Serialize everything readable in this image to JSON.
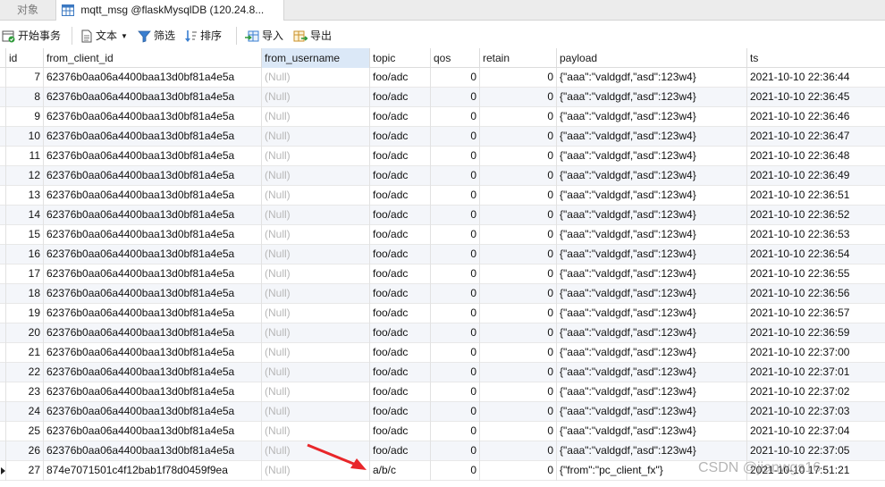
{
  "tabs": {
    "objects": "对象",
    "active": "mqtt_msg @flaskMysqlDB (120.24.8..."
  },
  "toolbar": {
    "begin_transaction": "开始事务",
    "text": "文本",
    "filter": "筛选",
    "sort": "排序",
    "import": "导入",
    "export": "导出"
  },
  "columns": [
    "id",
    "from_client_id",
    "from_username",
    "topic",
    "qos",
    "retain",
    "payload",
    "ts"
  ],
  "selected_column": "from_username",
  "rows": [
    {
      "id": "7",
      "from_client_id": "62376b0aa06a4400baa13d0bf81a4e5a",
      "from_username": "(Null)",
      "topic": "foo/adc",
      "qos": "0",
      "retain": "0",
      "payload": "{\"aaa\":\"valdgdf,\"asd\":123w4}",
      "ts": "2021-10-10 22:36:44"
    },
    {
      "id": "8",
      "from_client_id": "62376b0aa06a4400baa13d0bf81a4e5a",
      "from_username": "(Null)",
      "topic": "foo/adc",
      "qos": "0",
      "retain": "0",
      "payload": "{\"aaa\":\"valdgdf,\"asd\":123w4}",
      "ts": "2021-10-10 22:36:45"
    },
    {
      "id": "9",
      "from_client_id": "62376b0aa06a4400baa13d0bf81a4e5a",
      "from_username": "(Null)",
      "topic": "foo/adc",
      "qos": "0",
      "retain": "0",
      "payload": "{\"aaa\":\"valdgdf,\"asd\":123w4}",
      "ts": "2021-10-10 22:36:46"
    },
    {
      "id": "10",
      "from_client_id": "62376b0aa06a4400baa13d0bf81a4e5a",
      "from_username": "(Null)",
      "topic": "foo/adc",
      "qos": "0",
      "retain": "0",
      "payload": "{\"aaa\":\"valdgdf,\"asd\":123w4}",
      "ts": "2021-10-10 22:36:47"
    },
    {
      "id": "11",
      "from_client_id": "62376b0aa06a4400baa13d0bf81a4e5a",
      "from_username": "(Null)",
      "topic": "foo/adc",
      "qos": "0",
      "retain": "0",
      "payload": "{\"aaa\":\"valdgdf,\"asd\":123w4}",
      "ts": "2021-10-10 22:36:48"
    },
    {
      "id": "12",
      "from_client_id": "62376b0aa06a4400baa13d0bf81a4e5a",
      "from_username": "(Null)",
      "topic": "foo/adc",
      "qos": "0",
      "retain": "0",
      "payload": "{\"aaa\":\"valdgdf,\"asd\":123w4}",
      "ts": "2021-10-10 22:36:49"
    },
    {
      "id": "13",
      "from_client_id": "62376b0aa06a4400baa13d0bf81a4e5a",
      "from_username": "(Null)",
      "topic": "foo/adc",
      "qos": "0",
      "retain": "0",
      "payload": "{\"aaa\":\"valdgdf,\"asd\":123w4}",
      "ts": "2021-10-10 22:36:51"
    },
    {
      "id": "14",
      "from_client_id": "62376b0aa06a4400baa13d0bf81a4e5a",
      "from_username": "(Null)",
      "topic": "foo/adc",
      "qos": "0",
      "retain": "0",
      "payload": "{\"aaa\":\"valdgdf,\"asd\":123w4}",
      "ts": "2021-10-10 22:36:52"
    },
    {
      "id": "15",
      "from_client_id": "62376b0aa06a4400baa13d0bf81a4e5a",
      "from_username": "(Null)",
      "topic": "foo/adc",
      "qos": "0",
      "retain": "0",
      "payload": "{\"aaa\":\"valdgdf,\"asd\":123w4}",
      "ts": "2021-10-10 22:36:53"
    },
    {
      "id": "16",
      "from_client_id": "62376b0aa06a4400baa13d0bf81a4e5a",
      "from_username": "(Null)",
      "topic": "foo/adc",
      "qos": "0",
      "retain": "0",
      "payload": "{\"aaa\":\"valdgdf,\"asd\":123w4}",
      "ts": "2021-10-10 22:36:54"
    },
    {
      "id": "17",
      "from_client_id": "62376b0aa06a4400baa13d0bf81a4e5a",
      "from_username": "(Null)",
      "topic": "foo/adc",
      "qos": "0",
      "retain": "0",
      "payload": "{\"aaa\":\"valdgdf,\"asd\":123w4}",
      "ts": "2021-10-10 22:36:55"
    },
    {
      "id": "18",
      "from_client_id": "62376b0aa06a4400baa13d0bf81a4e5a",
      "from_username": "(Null)",
      "topic": "foo/adc",
      "qos": "0",
      "retain": "0",
      "payload": "{\"aaa\":\"valdgdf,\"asd\":123w4}",
      "ts": "2021-10-10 22:36:56"
    },
    {
      "id": "19",
      "from_client_id": "62376b0aa06a4400baa13d0bf81a4e5a",
      "from_username": "(Null)",
      "topic": "foo/adc",
      "qos": "0",
      "retain": "0",
      "payload": "{\"aaa\":\"valdgdf,\"asd\":123w4}",
      "ts": "2021-10-10 22:36:57"
    },
    {
      "id": "20",
      "from_client_id": "62376b0aa06a4400baa13d0bf81a4e5a",
      "from_username": "(Null)",
      "topic": "foo/adc",
      "qos": "0",
      "retain": "0",
      "payload": "{\"aaa\":\"valdgdf,\"asd\":123w4}",
      "ts": "2021-10-10 22:36:59"
    },
    {
      "id": "21",
      "from_client_id": "62376b0aa06a4400baa13d0bf81a4e5a",
      "from_username": "(Null)",
      "topic": "foo/adc",
      "qos": "0",
      "retain": "0",
      "payload": "{\"aaa\":\"valdgdf,\"asd\":123w4}",
      "ts": "2021-10-10 22:37:00"
    },
    {
      "id": "22",
      "from_client_id": "62376b0aa06a4400baa13d0bf81a4e5a",
      "from_username": "(Null)",
      "topic": "foo/adc",
      "qos": "0",
      "retain": "0",
      "payload": "{\"aaa\":\"valdgdf,\"asd\":123w4}",
      "ts": "2021-10-10 22:37:01"
    },
    {
      "id": "23",
      "from_client_id": "62376b0aa06a4400baa13d0bf81a4e5a",
      "from_username": "(Null)",
      "topic": "foo/adc",
      "qos": "0",
      "retain": "0",
      "payload": "{\"aaa\":\"valdgdf,\"asd\":123w4}",
      "ts": "2021-10-10 22:37:02"
    },
    {
      "id": "24",
      "from_client_id": "62376b0aa06a4400baa13d0bf81a4e5a",
      "from_username": "(Null)",
      "topic": "foo/adc",
      "qos": "0",
      "retain": "0",
      "payload": "{\"aaa\":\"valdgdf,\"asd\":123w4}",
      "ts": "2021-10-10 22:37:03"
    },
    {
      "id": "25",
      "from_client_id": "62376b0aa06a4400baa13d0bf81a4e5a",
      "from_username": "(Null)",
      "topic": "foo/adc",
      "qos": "0",
      "retain": "0",
      "payload": "{\"aaa\":\"valdgdf,\"asd\":123w4}",
      "ts": "2021-10-10 22:37:04"
    },
    {
      "id": "26",
      "from_client_id": "62376b0aa06a4400baa13d0bf81a4e5a",
      "from_username": "(Null)",
      "topic": "foo/adc",
      "qos": "0",
      "retain": "0",
      "payload": "{\"aaa\":\"valdgdf,\"asd\":123w4}",
      "ts": "2021-10-10 22:37:05"
    },
    {
      "id": "27",
      "from_client_id": "874e7071501c4f12bab1f78d0459f9ea",
      "from_username": "(Null)",
      "topic": "a/b/c",
      "qos": "0",
      "retain": "0",
      "payload": "{\"from\":\"pc_client_fx\"}",
      "ts": "2021-10-10 17:51:21"
    }
  ],
  "watermark": "CSDN @jianwgs16",
  "colors": {
    "selected_header": "#dbe8f7",
    "null_text": "#b7b7b7",
    "annotation_arrow": "#e8262a"
  }
}
